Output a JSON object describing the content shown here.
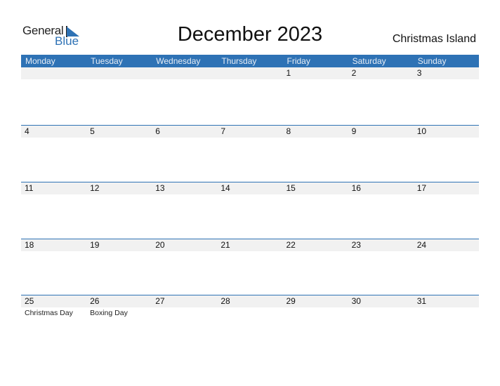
{
  "logo": {
    "word1": "General",
    "word2": "Blue"
  },
  "title": "December 2023",
  "region": "Christmas Island",
  "colors": {
    "accent": "#2e72b5",
    "band": "#f1f1f1"
  },
  "weekdays": [
    "Monday",
    "Tuesday",
    "Wednesday",
    "Thursday",
    "Friday",
    "Saturday",
    "Sunday"
  ],
  "weeks": [
    {
      "days": [
        "",
        "",
        "",
        "",
        "1",
        "2",
        "3"
      ],
      "notes": [
        "",
        "",
        "",
        "",
        "",
        "",
        ""
      ]
    },
    {
      "days": [
        "4",
        "5",
        "6",
        "7",
        "8",
        "9",
        "10"
      ],
      "notes": [
        "",
        "",
        "",
        "",
        "",
        "",
        ""
      ]
    },
    {
      "days": [
        "11",
        "12",
        "13",
        "14",
        "15",
        "16",
        "17"
      ],
      "notes": [
        "",
        "",
        "",
        "",
        "",
        "",
        ""
      ]
    },
    {
      "days": [
        "18",
        "19",
        "20",
        "21",
        "22",
        "23",
        "24"
      ],
      "notes": [
        "",
        "",
        "",
        "",
        "",
        "",
        ""
      ]
    },
    {
      "days": [
        "25",
        "26",
        "27",
        "28",
        "29",
        "30",
        "31"
      ],
      "notes": [
        "Christmas Day",
        "Boxing Day",
        "",
        "",
        "",
        "",
        ""
      ]
    }
  ]
}
